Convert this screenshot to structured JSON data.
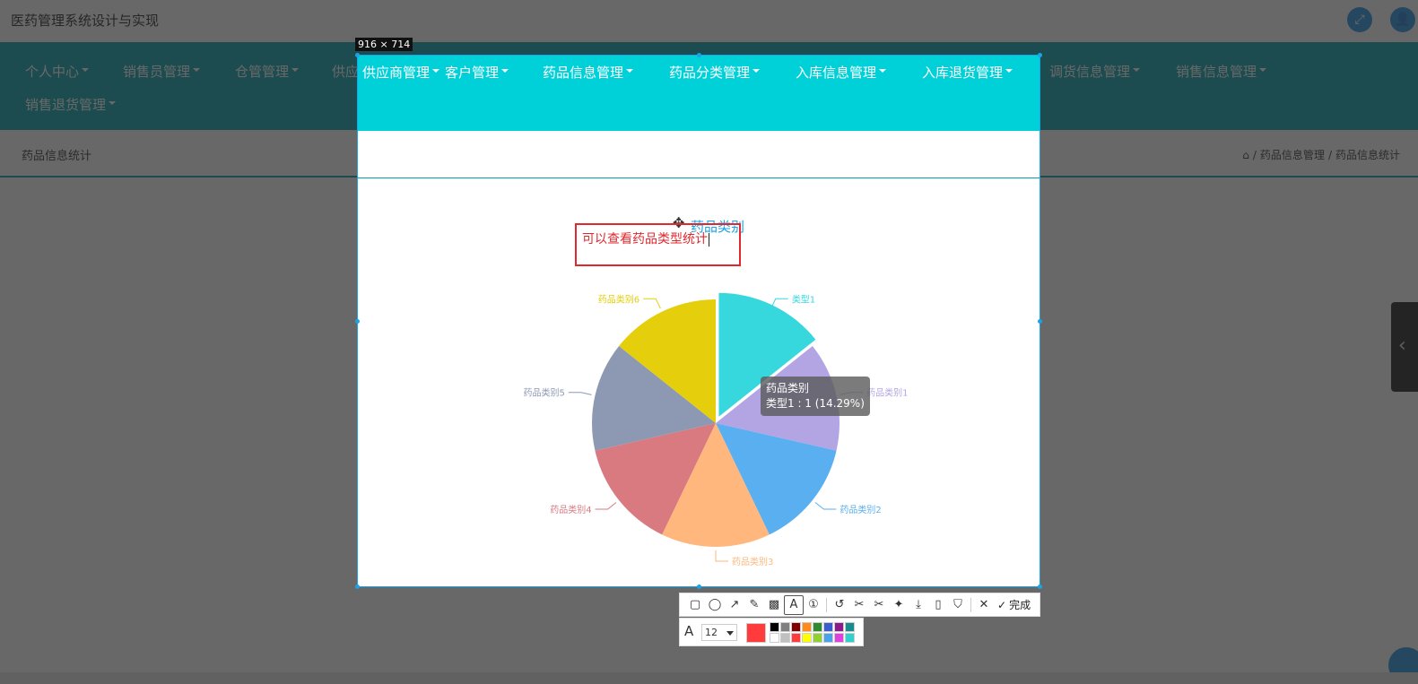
{
  "app": {
    "title": "医药管理系统设计与实现"
  },
  "nav": {
    "items": [
      {
        "label": "个人中心"
      },
      {
        "label": "销售员管理"
      },
      {
        "label": "仓管管理"
      },
      {
        "label": "供应商管理"
      },
      {
        "label": "客户管理"
      },
      {
        "label": "药品信息管理"
      },
      {
        "label": "药品分类管理"
      },
      {
        "label": "入库信息管理"
      },
      {
        "label": "入库退货管理"
      },
      {
        "label": "调货信息管理"
      },
      {
        "label": "销售信息管理"
      },
      {
        "label": "销售退货管理"
      }
    ]
  },
  "page": {
    "title": "药品信息统计",
    "breadcrumb": [
      "药品信息管理",
      "药品信息统计"
    ],
    "breadcrumb_sep": "/"
  },
  "capture": {
    "size_label": "916 × 714",
    "annotation_text": "可以查看药品类型统计"
  },
  "chart_data": {
    "type": "pie",
    "title": "药品类别",
    "categories": [
      "类型1",
      "药品类别1",
      "药品类别2",
      "药品类别3",
      "药品类别4",
      "药品类别5",
      "药品类别6"
    ],
    "values": [
      1,
      1,
      1,
      1,
      1,
      1,
      1
    ],
    "colors": [
      "#37d8dd",
      "#b3a5e3",
      "#5aaff0",
      "#ffb77d",
      "#d97a80",
      "#8d98b3",
      "#e5cf0d"
    ],
    "highlighted_index": 0,
    "tooltip": {
      "title": "药品类别",
      "line": "类型1 : 1 (14.29%)"
    }
  },
  "toolbar": {
    "tools": [
      "rectangle-icon",
      "ellipse-icon",
      "arrow-icon",
      "pencil-icon",
      "mosaic-icon",
      "text-icon",
      "number-icon",
      "undo-icon",
      "scissors-icon",
      "scissors-pin-icon",
      "pin-icon",
      "download-icon",
      "long-screenshot-icon",
      "bookmark-icon",
      "close-icon"
    ],
    "done_label": "完成",
    "font_size": "12",
    "current_color": "#ff3b3b",
    "palette": [
      "#000000",
      "#808080",
      "#800000",
      "#ff8c1a",
      "#2e8b2e",
      "#3a5fcd",
      "#8b1a8b",
      "#1a8b8b",
      "#ffffff",
      "#c0c0c0",
      "#ff3b3b",
      "#ffff00",
      "#90d030",
      "#4aa3e8",
      "#e040e0",
      "#30d0d0"
    ]
  }
}
